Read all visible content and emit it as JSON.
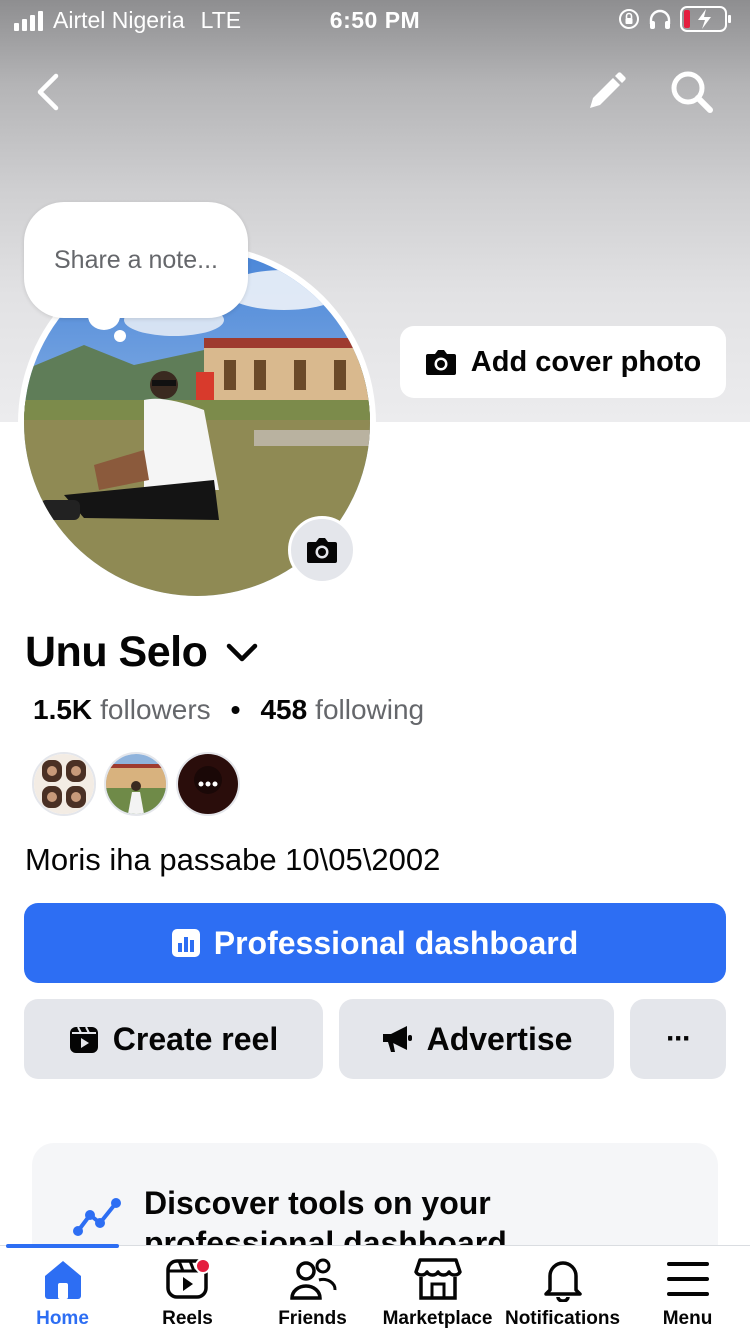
{
  "status_bar": {
    "carrier": "Airtel Nigeria",
    "network": "LTE",
    "time": "6:50 PM"
  },
  "header": {
    "back_icon": "chevron-left-icon",
    "edit_icon": "pencil-icon",
    "search_icon": "search-icon"
  },
  "cover": {
    "add_cover_label": "Add cover photo"
  },
  "note": {
    "placeholder": "Share a note..."
  },
  "profile": {
    "name": "Unu Selo",
    "followers_count": "1.5K",
    "followers_label": "followers",
    "separator": "•",
    "following_count": "458",
    "following_label": "following",
    "bio": "Moris iha passabe 10\\05\\2002"
  },
  "actions": {
    "professional_dashboard": "Professional dashboard",
    "create_reel": "Create reel",
    "advertise": "Advertise",
    "more": "···"
  },
  "discover": {
    "title": "Discover tools on your professional dashboard"
  },
  "tabs": [
    {
      "label": "Home",
      "icon": "home-icon",
      "active": true
    },
    {
      "label": "Reels",
      "icon": "reels-icon",
      "active": false
    },
    {
      "label": "Friends",
      "icon": "friends-icon",
      "active": false
    },
    {
      "label": "Marketplace",
      "icon": "marketplace-icon",
      "active": false
    },
    {
      "label": "Notifications",
      "icon": "bell-icon",
      "active": false
    },
    {
      "label": "Menu",
      "icon": "menu-icon",
      "active": false
    }
  ],
  "colors": {
    "accent": "#2d6ef3",
    "button_gray": "#e4e6eb",
    "badge_red": "#e41e3f"
  }
}
